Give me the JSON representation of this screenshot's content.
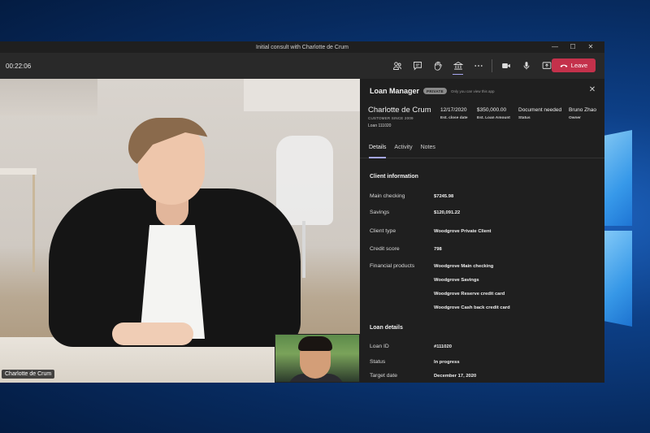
{
  "window": {
    "title": "Initial consult with Charlotte de Crum",
    "minimize_glyph": "—",
    "maximize_glyph": "☐",
    "close_glyph": "✕"
  },
  "toolbar": {
    "timer": "00:22:06",
    "leave_label": "Leave",
    "icons": [
      "participants-icon",
      "chat-icon",
      "raise-hand-icon",
      "loan-app-icon",
      "more-icon",
      "camera-icon",
      "mic-icon",
      "share-icon"
    ],
    "leave_color": "#c4314b",
    "active_indicator_color": "#a6a7f0"
  },
  "video": {
    "main_name": "Charlotte de Crum"
  },
  "panel": {
    "title": "Loan Manager",
    "badge": "PRIVATE",
    "visibility_note": "Only you can view this app",
    "close_glyph": "✕",
    "client": {
      "name": "Charlotte de Crum",
      "since": "CUSTOMER SINCE 2009",
      "loan": "Loan 111020"
    },
    "stats": [
      {
        "value": "12/17/2020",
        "label": "Est. close date"
      },
      {
        "value": "$350,000.00",
        "label": "Est. Loan Amount"
      },
      {
        "value": "Document needed",
        "label": "Status"
      },
      {
        "value": "Bruno Zhao",
        "label": "Owner"
      }
    ],
    "tabs": [
      {
        "label": "Details",
        "active": true
      },
      {
        "label": "Activity",
        "active": false
      },
      {
        "label": "Notes",
        "active": false
      }
    ],
    "client_info": {
      "heading": "Client information",
      "main_checking_label": "Main checking",
      "main_checking_value": "$7245.98",
      "savings_label": "Savings",
      "savings_value": "$120,091.22",
      "client_type_label": "Client type",
      "client_type_value": "Woodgrove Private Client",
      "credit_score_label": "Credit score",
      "credit_score_value": "798",
      "products_label": "Financial products",
      "products": [
        "Woodgrove Main checking",
        "Woodgrove Savings",
        "Woodgrove Reserve credit card",
        "Woodgrove Cash back credit card"
      ]
    },
    "loan_details": {
      "heading": "Loan details",
      "loan_id_label": "Loan ID",
      "loan_id_value": "#111020",
      "status_label": "Status",
      "status_value": "In progress",
      "target_date_label": "Target date",
      "target_date_value": "December 17, 2020"
    }
  }
}
